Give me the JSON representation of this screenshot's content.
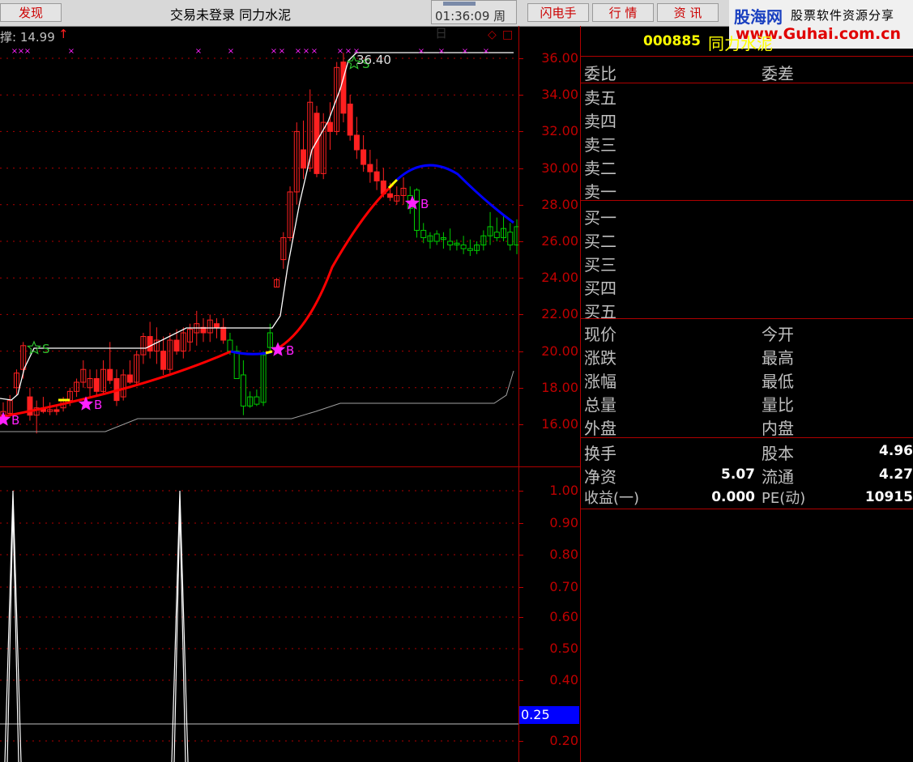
{
  "topbar": {
    "discover_label": "发现",
    "title": "交易未登录   同力水泥",
    "clock_time": "01:36:09",
    "clock_day": "周日",
    "buttons": [
      "闪电手",
      "行  情",
      "资  讯"
    ]
  },
  "watermark": {
    "brand": "股海网",
    "slogan": "股票软件资源分享",
    "url": "www.Guhai.com.cn"
  },
  "chart_header": {
    "left_label": "撑: 14.99"
  },
  "colors": {
    "up": "#ff2020",
    "down": "#00cc00",
    "ma_red": "#ff0000",
    "ma_blue": "#0000ff",
    "white_line": "#ffffff",
    "grid": "#b00000",
    "axis_text": "#c00000",
    "signal": "#ff20ff",
    "star_s": "#30c030"
  },
  "main_chart": {
    "axis_ticks": [
      "36.00",
      "34.00",
      "32.00",
      "30.00",
      "28.00",
      "26.00",
      "24.00",
      "22.00",
      "20.00",
      "18.00",
      "16.00"
    ],
    "peak_label": "36.40",
    "signals": [
      "S",
      "B",
      "B",
      "B",
      "S",
      "B"
    ]
  },
  "indicator_chart": {
    "axis_ticks": [
      "1.00",
      "0.90",
      "0.80",
      "0.70",
      "0.60",
      "0.50",
      "0.40",
      "0.25",
      "0.20"
    ],
    "highlight_value": "0.25"
  },
  "quote_panel": {
    "code": "000885",
    "name": "同力水泥",
    "header_left": "委比",
    "header_right": "委差",
    "sell_levels": [
      "卖五",
      "卖四",
      "卖三",
      "卖二",
      "卖一"
    ],
    "buy_levels": [
      "买一",
      "买二",
      "买三",
      "买四",
      "买五"
    ],
    "stats_left": [
      "现价",
      "涨跌",
      "涨幅",
      "总量",
      "外盘"
    ],
    "stats_right": [
      "今开",
      "最高",
      "最低",
      "量比",
      "内盘"
    ],
    "fund": {
      "turnover_label": "换手",
      "shares_label": "股本",
      "shares_value": "4.96",
      "net_asset_label": "净资",
      "net_asset_value": "5.07",
      "float_label": "流通",
      "float_value": "4.27",
      "eps_label": "收益(一)",
      "eps_value": "0.000",
      "pe_label": "PE(动)",
      "pe_value": "10915"
    }
  }
}
